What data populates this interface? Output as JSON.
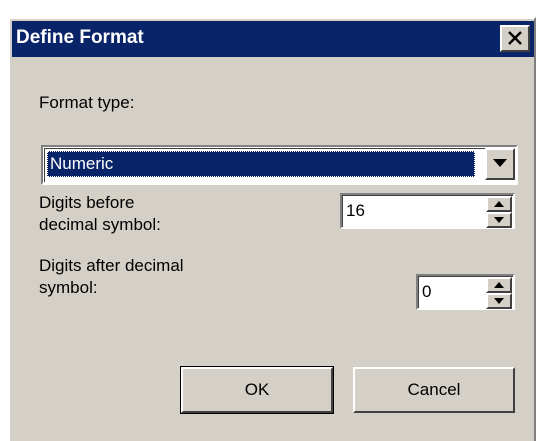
{
  "window": {
    "title": "Define Format",
    "close_symbol": "×",
    "close_icon": "close-icon"
  },
  "format_type": {
    "label": "Format type:",
    "selected_value": "Numeric",
    "dropdown_icon": "chevron-down-icon"
  },
  "digits_before": {
    "label_line1": "Digits before",
    "label_line2": "decimal symbol:",
    "value": "16"
  },
  "digits_after": {
    "label_line1": "Digits after decimal",
    "label_line2": "symbol:",
    "value": "0"
  },
  "buttons": {
    "ok_label": "OK",
    "cancel_label": "Cancel"
  },
  "colors": {
    "title_bar": "#0a246a",
    "dialog_background": "#d4d0c8",
    "selection_highlight": "#0a246a"
  }
}
